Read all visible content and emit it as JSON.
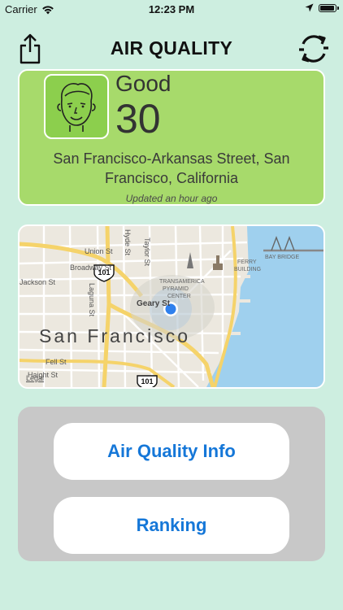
{
  "status_bar": {
    "carrier": "Carrier",
    "time": "12:23 PM"
  },
  "nav": {
    "title": "AIR QUALITY"
  },
  "aqi_card": {
    "level": "Good",
    "value": "30",
    "location": "San Francisco-Arkansas Street, San Francisco, California",
    "updated": "Updated an hour ago",
    "color": "#a7da6b"
  },
  "map": {
    "city_label": "San Francisco",
    "labels": {
      "union_st": "Union St",
      "broadway_st": "Broadway St",
      "jackson_st": "Jackson St",
      "hyde_st": "Hyde St",
      "taylor_st": "Taylor St",
      "laguna_st": "Laguna St",
      "geary_st": "Geary St",
      "fell_st": "Fell St",
      "haight_st": "Haight St",
      "highway_top": "101",
      "highway_bottom": "101",
      "transamerica": "TRANSAMERICA",
      "pyramid": "PYRAMID",
      "center": "CENTER",
      "ferry": "FERRY",
      "building": "BUILDING",
      "bay_bridge": "BAY BRIDGE",
      "legal": "Legal"
    }
  },
  "buttons": {
    "air_quality_info": "Air Quality Info",
    "ranking": "Ranking",
    "accent_color": "#1577d8"
  }
}
